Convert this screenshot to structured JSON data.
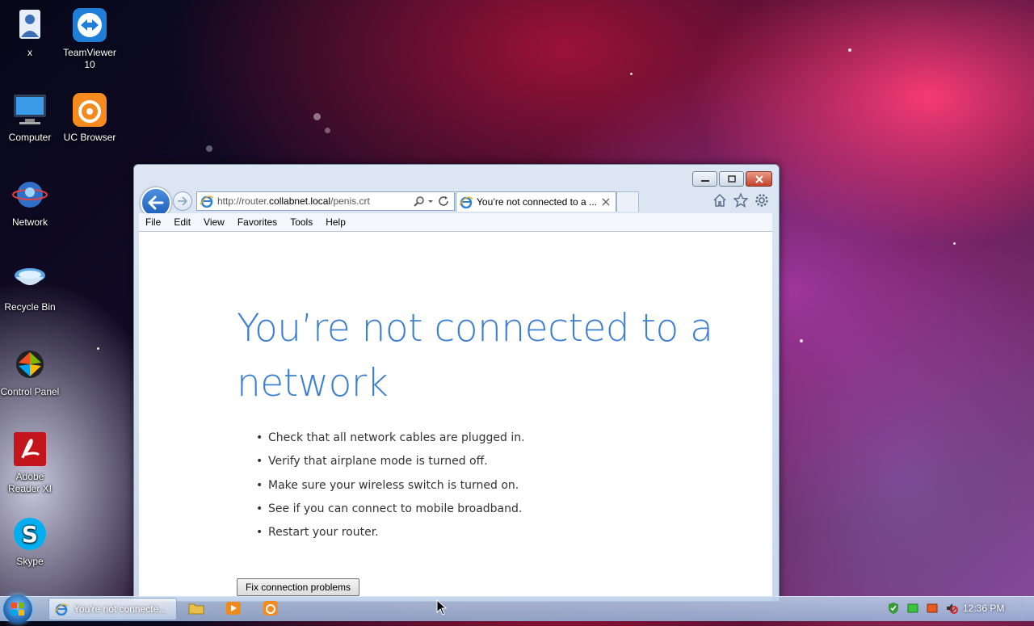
{
  "desktop": {
    "icons": [
      {
        "label": "x",
        "icon": "user-folder-icon"
      },
      {
        "label": "TeamViewer 10",
        "icon": "teamviewer-icon"
      },
      {
        "label": "Computer",
        "icon": "computer-icon"
      },
      {
        "label": "UC Browser",
        "icon": "uc-browser-icon"
      },
      {
        "label": "Network",
        "icon": "network-icon"
      },
      {
        "label": "Recycle Bin",
        "icon": "recycle-bin-icon"
      },
      {
        "label": "Control Panel",
        "icon": "control-panel-icon"
      },
      {
        "label": "Adobe Reader XI",
        "icon": "adobe-reader-icon"
      },
      {
        "label": "Skype",
        "icon": "skype-icon"
      }
    ]
  },
  "browser": {
    "address": {
      "prefix": "http://router.",
      "domain": "collabnet.local",
      "path": "/penis.crt"
    },
    "tab": {
      "title": "You’re not connected to a ..."
    },
    "menu": [
      "File",
      "Edit",
      "View",
      "Favorites",
      "Tools",
      "Help"
    ],
    "page": {
      "heading": "You’re not connected to a network",
      "tips": [
        "Check that all network cables are plugged in.",
        "Verify that airplane mode is turned off.",
        "Make sure your wireless switch is turned on.",
        "See if you can connect to mobile broadband.",
        "Restart your router."
      ],
      "fix_button": "Fix connection problems"
    }
  },
  "taskbar": {
    "active_task": "You're not connecte...",
    "clock": "12:36 PM"
  },
  "colors": {
    "heading_blue": "#3d7fd0",
    "close_red": "#c5422c"
  }
}
